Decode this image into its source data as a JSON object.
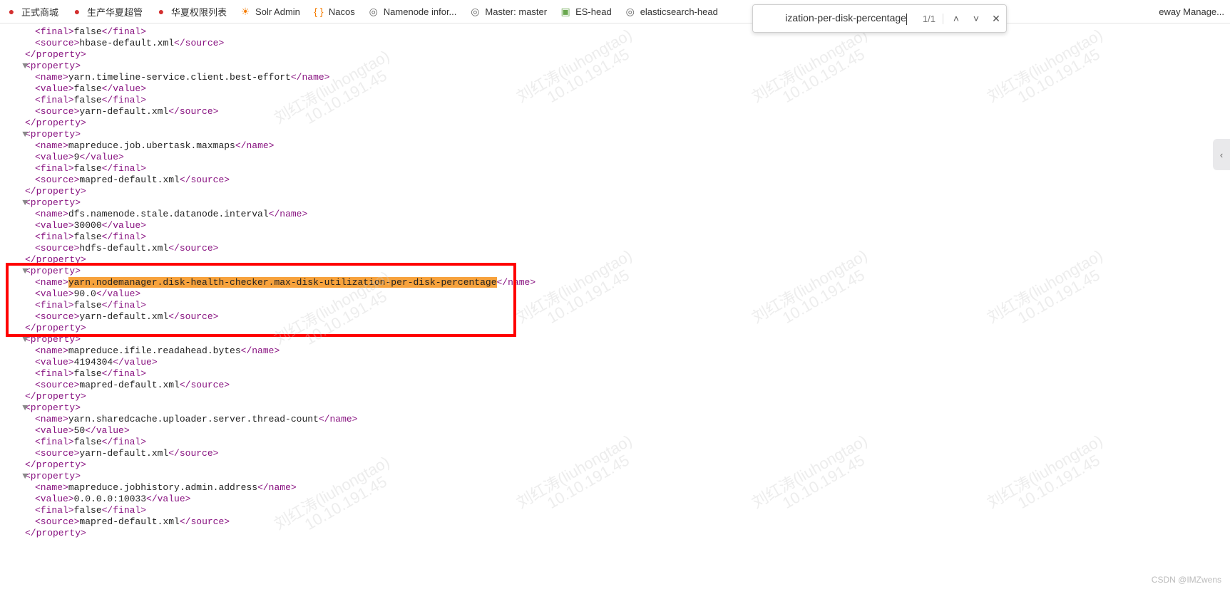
{
  "bookmarks": [
    {
      "icon": "●",
      "cls": "icon-red",
      "label": "正式商城"
    },
    {
      "icon": "●",
      "cls": "icon-red",
      "label": "生产华夏超管"
    },
    {
      "icon": "●",
      "cls": "icon-red",
      "label": "华夏权限列表"
    },
    {
      "icon": "☀",
      "cls": "icon-orange",
      "label": "Solr Admin"
    },
    {
      "icon": "{ }",
      "cls": "icon-orange",
      "label": "Nacos"
    },
    {
      "icon": "◎",
      "cls": "icon-gray",
      "label": "Namenode infor..."
    },
    {
      "icon": "◎",
      "cls": "icon-gray",
      "label": "Master: master"
    },
    {
      "icon": "▣",
      "cls": "icon-green",
      "label": "ES-head"
    },
    {
      "icon": "◎",
      "cls": "icon-gray",
      "label": "elasticsearch-head"
    },
    {
      "icon": "",
      "cls": "",
      "label": "eway Manage...",
      "trail": true
    }
  ],
  "find": {
    "value": "ization-per-disk-percentage",
    "count": "1/1"
  },
  "frag0": {
    "finalv": "false",
    "source": "hbase-default.xml"
  },
  "props": [
    {
      "name": "yarn.timeline-service.client.best-effort",
      "value": "false",
      "finalv": "false",
      "source": "yarn-default.xml",
      "hl": false
    },
    {
      "name": "mapreduce.job.ubertask.maxmaps",
      "value": "9",
      "finalv": "false",
      "source": "mapred-default.xml",
      "hl": false
    },
    {
      "name": "dfs.namenode.stale.datanode.interval",
      "value": "30000",
      "finalv": "false",
      "source": "hdfs-default.xml",
      "hl": false
    },
    {
      "name": "yarn.nodemanager.disk-health-checker.max-disk-utilization-per-disk-percentage",
      "value": "90.0",
      "finalv": "false",
      "source": "yarn-default.xml",
      "hl": true
    },
    {
      "name": "mapreduce.ifile.readahead.bytes",
      "value": "4194304",
      "finalv": "false",
      "source": "mapred-default.xml",
      "hl": false
    },
    {
      "name": "yarn.sharedcache.uploader.server.thread-count",
      "value": "50",
      "finalv": "false",
      "source": "yarn-default.xml",
      "hl": false
    },
    {
      "name": "mapreduce.jobhistory.admin.address",
      "value": "0.0.0.0:10033",
      "finalv": "false",
      "source": "mapred-default.xml",
      "hl": false
    }
  ],
  "watermarkLine1": "刘红涛(liuhongtao)",
  "watermarkLine2": "10.10.191.45",
  "credit": "CSDN @IMZwens"
}
